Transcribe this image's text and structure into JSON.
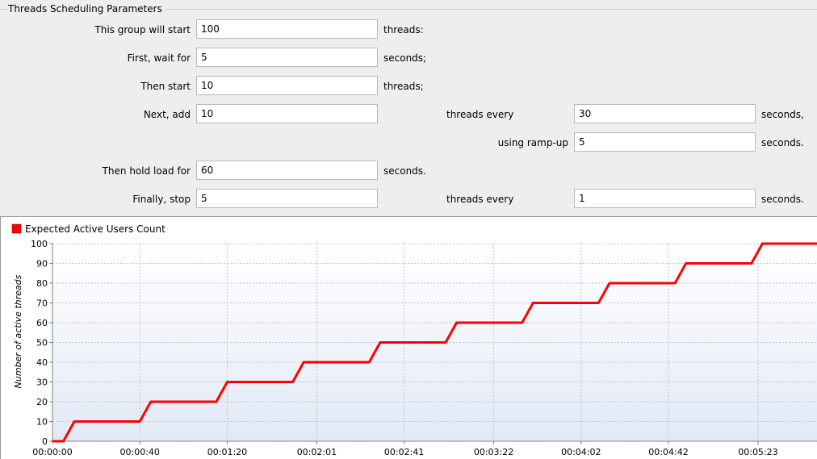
{
  "group_title": "Threads Scheduling Parameters",
  "params": {
    "start_label": "This group will start",
    "start_value": "100",
    "start_unit": "threads:",
    "wait_label": "First, wait for",
    "wait_value": "5",
    "wait_unit": "seconds;",
    "then_start_label": "Then start",
    "then_start_value": "10",
    "then_start_unit": "threads;",
    "next_add_label": "Next, add",
    "next_add_value": "10",
    "next_add_every_label": "threads every",
    "next_add_every_value": "30",
    "next_add_every_unit": "seconds,",
    "rampup_label": "using ramp-up",
    "rampup_value": "5",
    "rampup_unit": "seconds.",
    "hold_label": "Then hold load for",
    "hold_value": "60",
    "hold_unit": "seconds.",
    "stop_label": "Finally, stop",
    "stop_value": "5",
    "stop_every_label": "threads every",
    "stop_every_value": "1",
    "stop_every_unit": "seconds."
  },
  "chart_data": {
    "type": "line",
    "legend": {
      "position": "top-left"
    },
    "ylabel": "Number of active threads",
    "xlabel": "",
    "title": "",
    "ylim": [
      0,
      100
    ],
    "yticks": [
      0,
      10,
      20,
      30,
      40,
      50,
      60,
      70,
      80,
      90,
      100
    ],
    "xlim_seconds": [
      0,
      350
    ],
    "xticks": [
      {
        "t": 0,
        "label": "00:00:00"
      },
      {
        "t": 40,
        "label": "00:00:40"
      },
      {
        "t": 80,
        "label": "00:01:20"
      },
      {
        "t": 121,
        "label": "00:02:01"
      },
      {
        "t": 161,
        "label": "00:02:41"
      },
      {
        "t": 202,
        "label": "00:03:22"
      },
      {
        "t": 242,
        "label": "00:04:02"
      },
      {
        "t": 282,
        "label": "00:04:42"
      },
      {
        "t": 323,
        "label": "00:05:23"
      }
    ],
    "grid": true,
    "series": [
      {
        "name": "Expected Active Users Count",
        "color": "#ff0000",
        "x": [
          0,
          5,
          10,
          40,
          45,
          75,
          80,
          110,
          115,
          145,
          150,
          180,
          185,
          215,
          220,
          250,
          255,
          285,
          290,
          320,
          325,
          350
        ],
        "y": [
          0,
          0,
          10,
          10,
          20,
          20,
          30,
          30,
          40,
          40,
          50,
          50,
          60,
          60,
          70,
          70,
          80,
          80,
          90,
          90,
          100,
          100
        ]
      }
    ]
  }
}
